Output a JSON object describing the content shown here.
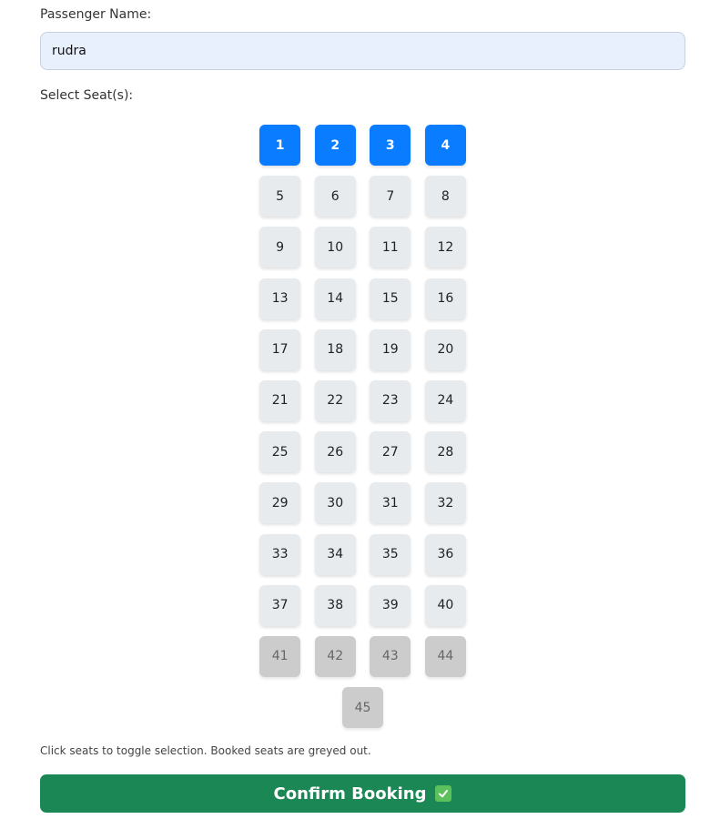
{
  "form": {
    "name_label": "Passenger Name:",
    "name_value": "rudra",
    "seats_label": "Select Seat(s):",
    "help_text": "Click seats to toggle selection. Booked seats are greyed out.",
    "confirm_label": "Confirm Booking",
    "confirm_icon": "check-box-icon"
  },
  "colors": {
    "selected_seat": "#0a7cff",
    "available_seat": "#e8ebee",
    "booked_seat": "#cccccc",
    "input_background": "#e8f0fe",
    "confirm_button": "#1a8754"
  },
  "seat_rows": [
    [
      {
        "number": "1",
        "status": "selected"
      },
      {
        "number": "2",
        "status": "selected"
      },
      {
        "number": "3",
        "status": "selected"
      },
      {
        "number": "4",
        "status": "selected"
      }
    ],
    [
      {
        "number": "5",
        "status": "available"
      },
      {
        "number": "6",
        "status": "available"
      },
      {
        "number": "7",
        "status": "available"
      },
      {
        "number": "8",
        "status": "available"
      }
    ],
    [
      {
        "number": "9",
        "status": "available"
      },
      {
        "number": "10",
        "status": "available"
      },
      {
        "number": "11",
        "status": "available"
      },
      {
        "number": "12",
        "status": "available"
      }
    ],
    [
      {
        "number": "13",
        "status": "available"
      },
      {
        "number": "14",
        "status": "available"
      },
      {
        "number": "15",
        "status": "available"
      },
      {
        "number": "16",
        "status": "available"
      }
    ],
    [
      {
        "number": "17",
        "status": "available"
      },
      {
        "number": "18",
        "status": "available"
      },
      {
        "number": "19",
        "status": "available"
      },
      {
        "number": "20",
        "status": "available"
      }
    ],
    [
      {
        "number": "21",
        "status": "available"
      },
      {
        "number": "22",
        "status": "available"
      },
      {
        "number": "23",
        "status": "available"
      },
      {
        "number": "24",
        "status": "available"
      }
    ],
    [
      {
        "number": "25",
        "status": "available"
      },
      {
        "number": "26",
        "status": "available"
      },
      {
        "number": "27",
        "status": "available"
      },
      {
        "number": "28",
        "status": "available"
      }
    ],
    [
      {
        "number": "29",
        "status": "available"
      },
      {
        "number": "30",
        "status": "available"
      },
      {
        "number": "31",
        "status": "available"
      },
      {
        "number": "32",
        "status": "available"
      }
    ],
    [
      {
        "number": "33",
        "status": "available"
      },
      {
        "number": "34",
        "status": "available"
      },
      {
        "number": "35",
        "status": "available"
      },
      {
        "number": "36",
        "status": "available"
      }
    ],
    [
      {
        "number": "37",
        "status": "available"
      },
      {
        "number": "38",
        "status": "available"
      },
      {
        "number": "39",
        "status": "available"
      },
      {
        "number": "40",
        "status": "available"
      }
    ],
    [
      {
        "number": "41",
        "status": "booked"
      },
      {
        "number": "42",
        "status": "booked"
      },
      {
        "number": "43",
        "status": "booked"
      },
      {
        "number": "44",
        "status": "booked"
      }
    ],
    [
      {
        "number": "45",
        "status": "booked"
      }
    ]
  ]
}
